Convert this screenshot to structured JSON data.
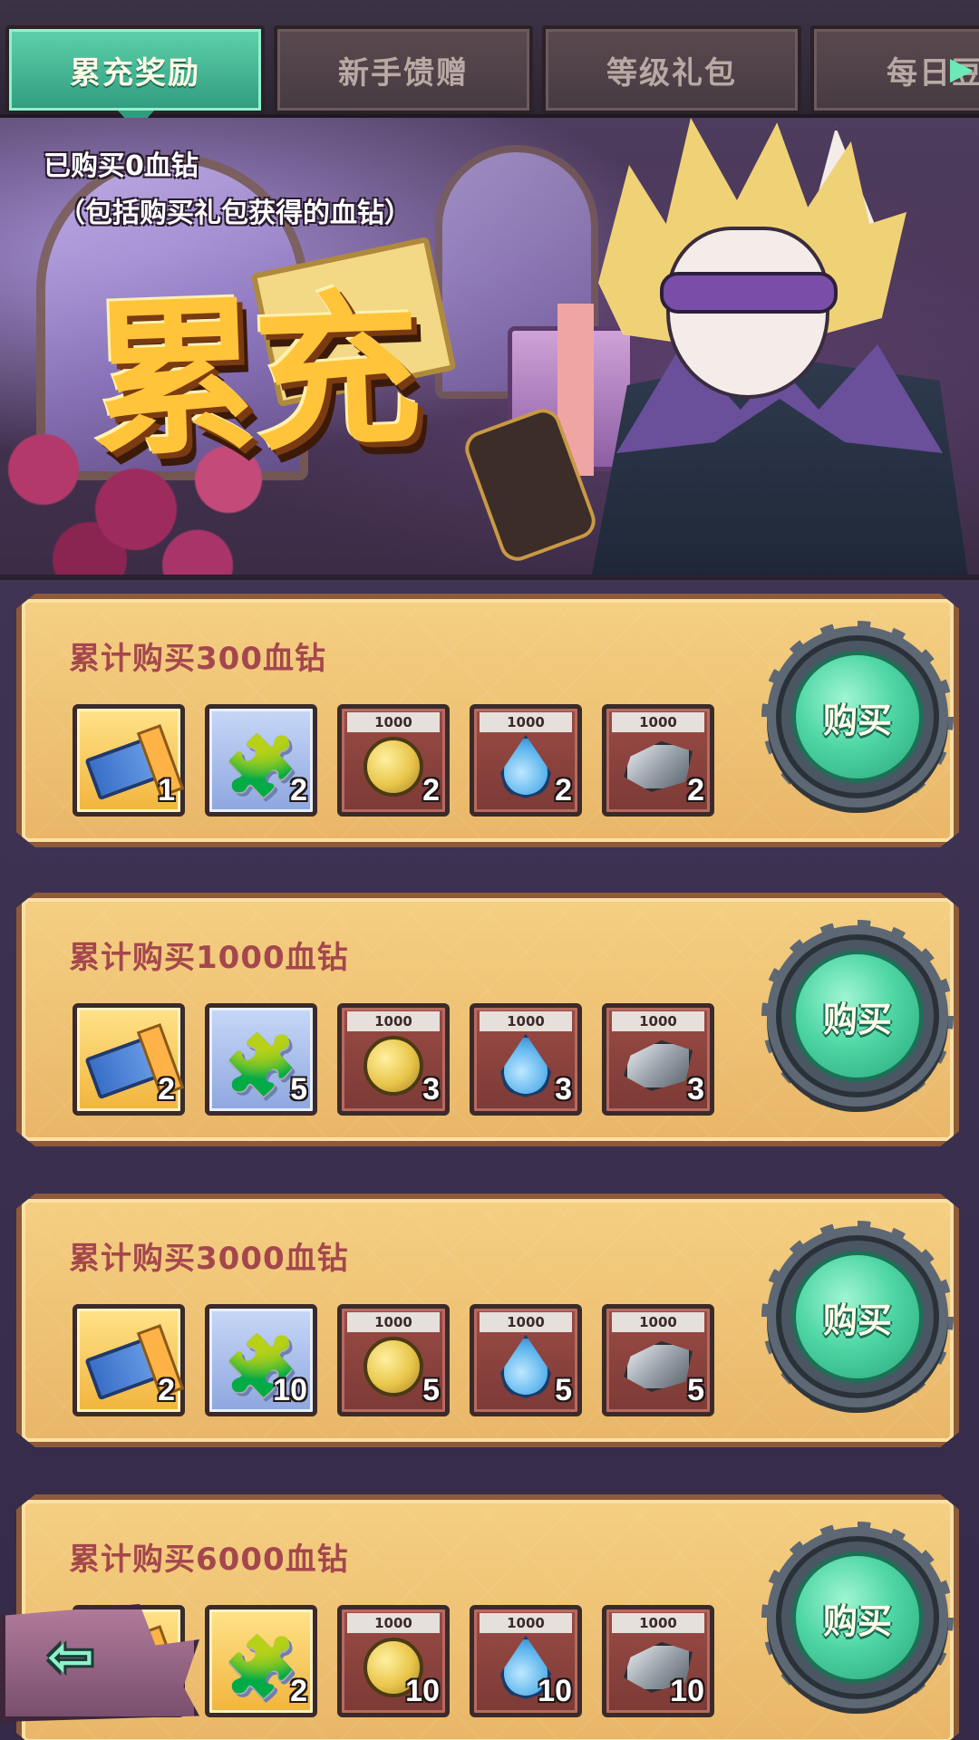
{
  "tabs": [
    {
      "label": "累充奖励",
      "active": true
    },
    {
      "label": "新手馈赠",
      "active": false
    },
    {
      "label": "等级礼包",
      "active": false
    },
    {
      "label": "每日豆",
      "active": false
    }
  ],
  "tab_scroll_icon": "play-right-icon",
  "banner": {
    "title": "累充",
    "purchased_line": "已购买0血钻",
    "note_line": "（包括购买礼包获得的血钻）"
  },
  "colors": {
    "tab_active": "#2f9c7e",
    "row_title": "#a4474d",
    "buy_button": "#4fd6a5"
  },
  "rows": [
    {
      "title": "累计购买300血钻",
      "buy_label": "购买",
      "items": [
        {
          "icon": "ticket-icon",
          "frame": "gold",
          "qty": "1",
          "cap": ""
        },
        {
          "icon": "puzzle-icon",
          "frame": "blue",
          "qty": "2",
          "cap": ""
        },
        {
          "icon": "coin-icon",
          "frame": "red",
          "qty": "2",
          "cap": "1000"
        },
        {
          "icon": "water-drop-icon",
          "frame": "red",
          "qty": "2",
          "cap": "1000"
        },
        {
          "icon": "ore-icon",
          "frame": "red",
          "qty": "2",
          "cap": "1000"
        }
      ]
    },
    {
      "title": "累计购买1000血钻",
      "buy_label": "购买",
      "items": [
        {
          "icon": "ticket-icon",
          "frame": "gold",
          "qty": "2",
          "cap": ""
        },
        {
          "icon": "puzzle-icon",
          "frame": "blue",
          "qty": "5",
          "cap": ""
        },
        {
          "icon": "coin-icon",
          "frame": "red",
          "qty": "3",
          "cap": "1000"
        },
        {
          "icon": "water-drop-icon",
          "frame": "red",
          "qty": "3",
          "cap": "1000"
        },
        {
          "icon": "ore-icon",
          "frame": "red",
          "qty": "3",
          "cap": "1000"
        }
      ]
    },
    {
      "title": "累计购买3000血钻",
      "buy_label": "购买",
      "items": [
        {
          "icon": "ticket-icon",
          "frame": "gold",
          "qty": "2",
          "cap": ""
        },
        {
          "icon": "puzzle-icon",
          "frame": "blue",
          "qty": "10",
          "cap": ""
        },
        {
          "icon": "coin-icon",
          "frame": "red",
          "qty": "5",
          "cap": "1000"
        },
        {
          "icon": "water-drop-icon",
          "frame": "red",
          "qty": "5",
          "cap": "1000"
        },
        {
          "icon": "ore-icon",
          "frame": "red",
          "qty": "5",
          "cap": "1000"
        }
      ]
    },
    {
      "title": "累计购买6000血钻",
      "buy_label": "购买",
      "items": [
        {
          "icon": "ticket-icon",
          "frame": "gold",
          "qty": "",
          "cap": ""
        },
        {
          "icon": "puzzle-icon",
          "frame": "gold",
          "qty": "2",
          "cap": ""
        },
        {
          "icon": "coin-icon",
          "frame": "red",
          "qty": "10",
          "cap": "1000"
        },
        {
          "icon": "water-drop-icon",
          "frame": "red",
          "qty": "10",
          "cap": "1000"
        },
        {
          "icon": "ore-icon",
          "frame": "red",
          "qty": "10",
          "cap": "1000"
        }
      ]
    }
  ],
  "back_button_icon": "back-arrow-icon"
}
